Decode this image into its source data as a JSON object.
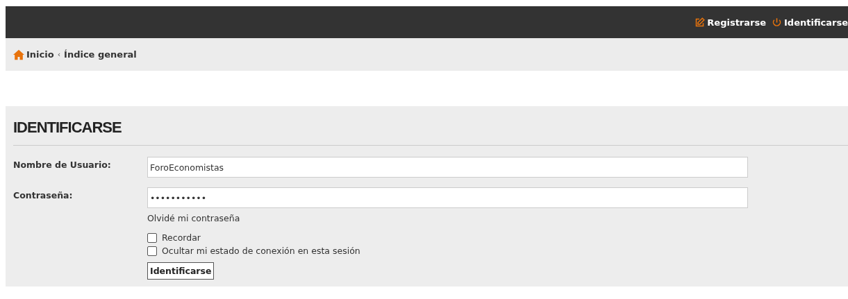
{
  "top_bar": {
    "links": [
      {
        "kind": "register",
        "label": "Registrarse"
      },
      {
        "kind": "login",
        "label": "Identificarse"
      }
    ]
  },
  "breadcrumb": [
    {
      "kind": "home",
      "label": "Inicio"
    },
    {
      "kind": "separator",
      "label": "‹"
    },
    {
      "kind": "link",
      "label": "Índice general"
    }
  ],
  "login": {
    "title": "IDENTIFICARSE",
    "fields": [
      {
        "label": "Nombre de Usuario:",
        "value": "ForoEconomistas"
      },
      {
        "label": "Contraseña:",
        "value": "•••••••••••"
      }
    ],
    "forgot_link": "Olvidé mi contraseña",
    "options": [
      {
        "label": "Recordar",
        "checked": false
      },
      {
        "label": "Ocultar mi estado de conexión en esta sesión",
        "checked": false
      }
    ],
    "submit": "Identificarse"
  }
}
